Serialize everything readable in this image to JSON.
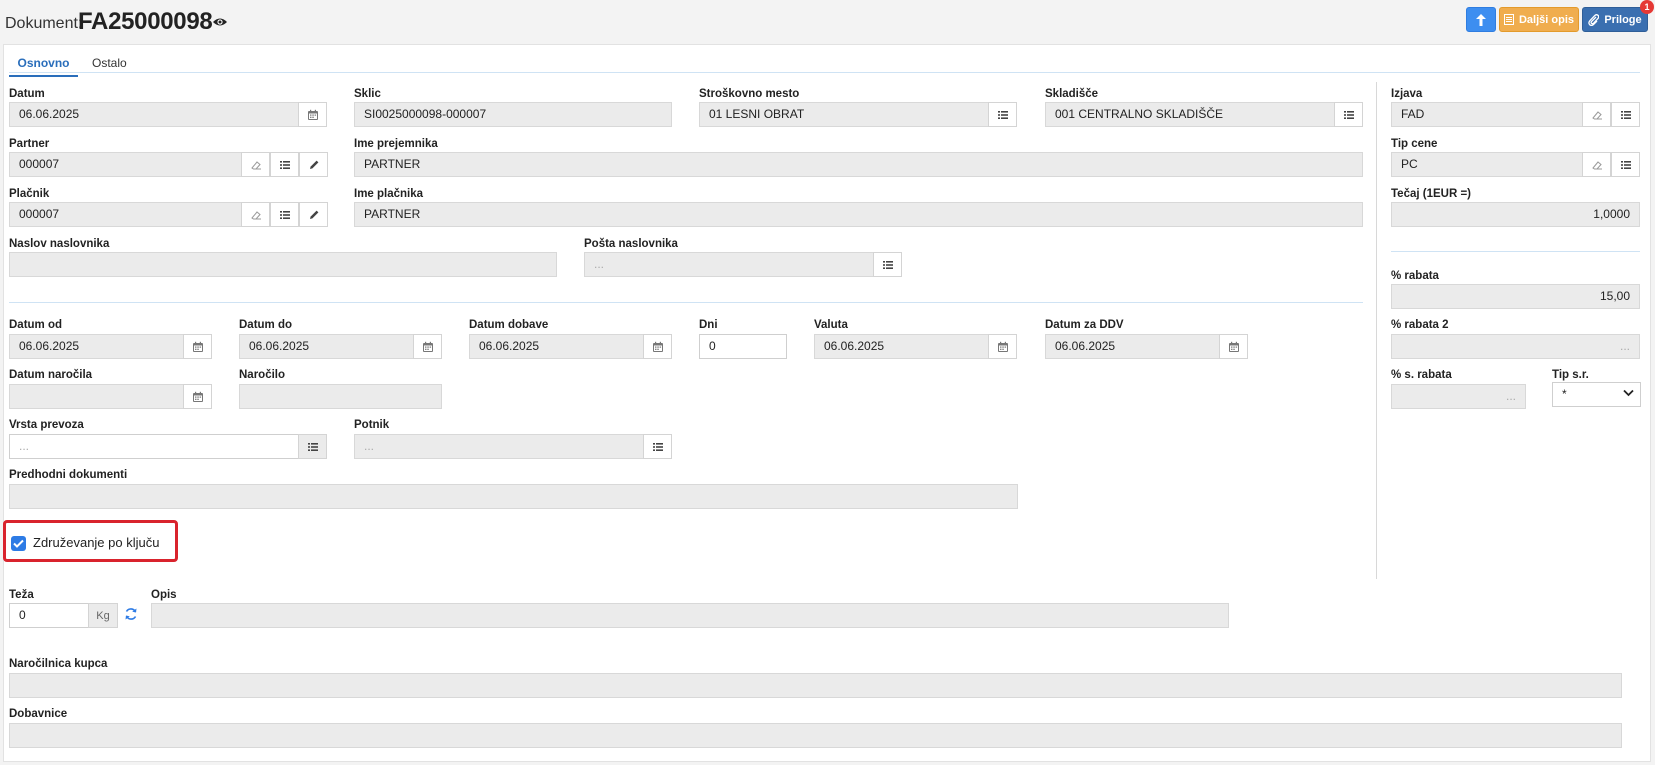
{
  "header": {
    "label": "Dokument:",
    "doc_number": "FA25000098",
    "buttons": {
      "opis": "Daljši opis",
      "priloge": "Priloge"
    },
    "badge": "1"
  },
  "tabs": [
    "Osnovno",
    "Ostalo"
  ],
  "fields": {
    "datum": {
      "label": "Datum",
      "value": "06.06.2025"
    },
    "sklic": {
      "label": "Sklic",
      "value": "SI0025000098-000007"
    },
    "strosk": {
      "label": "Stroškovno mesto",
      "value": "01 LESNI OBRAT"
    },
    "skladisce": {
      "label": "Skladišče",
      "value": "001 CENTRALNO SKLADIŠČE"
    },
    "izjava": {
      "label": "Izjava",
      "value": "FAD"
    },
    "partner": {
      "label": "Partner",
      "value": "000007"
    },
    "ime_prejemnika": {
      "label": "Ime prejemnika",
      "value": "PARTNER"
    },
    "tip_cene": {
      "label": "Tip cene",
      "value": "PC"
    },
    "placnik": {
      "label": "Plačnik",
      "value": "000007"
    },
    "ime_placnika": {
      "label": "Ime plačnika",
      "value": "PARTNER"
    },
    "tecaj": {
      "label": "Tečaj (1EUR =)",
      "value": "1,0000"
    },
    "naslov": {
      "label": "Naslov naslovnika",
      "value": ""
    },
    "posta": {
      "label": "Pošta naslovnika",
      "value": "",
      "placeholder": "..."
    },
    "rabat": {
      "label": "% rabata",
      "value": "15,00"
    },
    "datum_od": {
      "label": "Datum od",
      "value": "06.06.2025"
    },
    "datum_do": {
      "label": "Datum do",
      "value": "06.06.2025"
    },
    "datum_dobave": {
      "label": "Datum dobave",
      "value": "06.06.2025"
    },
    "dni": {
      "label": "Dni",
      "value": "0"
    },
    "valuta": {
      "label": "Valuta",
      "value": "06.06.2025"
    },
    "datum_ddv": {
      "label": "Datum za DDV",
      "value": "06.06.2025"
    },
    "rabat2": {
      "label": "% rabata 2",
      "value": "",
      "placeholder": "..."
    },
    "datum_narocila": {
      "label": "Datum naročila",
      "value": ""
    },
    "narocilo": {
      "label": "Naročilo",
      "value": ""
    },
    "s_rabat": {
      "label": "% s. rabata",
      "value": "",
      "placeholder": "..."
    },
    "tip_sr": {
      "label": "Tip s.r.",
      "value": "*"
    },
    "vrsta_prevoza": {
      "label": "Vrsta prevoza",
      "value": "",
      "placeholder": "..."
    },
    "potnik": {
      "label": "Potnik",
      "value": "",
      "placeholder": "..."
    },
    "predhodni": {
      "label": "Predhodni dokumenti",
      "value": ""
    },
    "teza": {
      "label": "Teža",
      "value": "0",
      "unit": "Kg"
    },
    "opis": {
      "label": "Opis",
      "value": ""
    },
    "narocilnica": {
      "label": "Naročilnica kupca",
      "value": ""
    },
    "dobavnice": {
      "label": "Dobavnice",
      "value": ""
    }
  },
  "checkbox": {
    "label": "Združevanje po ključu",
    "checked": true
  },
  "colors": {
    "accent": "#2a6ebb",
    "highlight": "#d9232d",
    "warn": "#f0ad4e"
  }
}
